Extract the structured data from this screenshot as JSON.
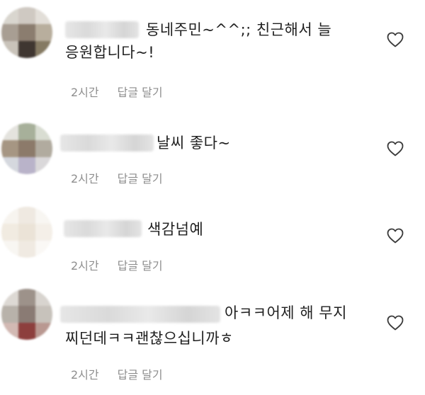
{
  "comments": [
    {
      "text_line1": "동네주민~^^;; 친근해서 늘",
      "text_line2": "응원합니다~!",
      "time": "2시간",
      "reply_label": "답글 달기",
      "like_icon": "heart-outline-icon"
    },
    {
      "text_line1": "날씨 좋다~",
      "time": "2시간",
      "reply_label": "답글 달기",
      "like_icon": "heart-outline-icon"
    },
    {
      "text_line1": "색감넘예",
      "time": "2시간",
      "reply_label": "답글 달기",
      "like_icon": "heart-outline-icon"
    },
    {
      "text_line1": "아ㅋㅋ어제 해 무지",
      "text_line2": "찌던데ㅋㅋ괜찮으십니까ㅎ",
      "time": "2시간",
      "reply_label": "답글 달기",
      "like_icon": "heart-outline-icon"
    }
  ]
}
